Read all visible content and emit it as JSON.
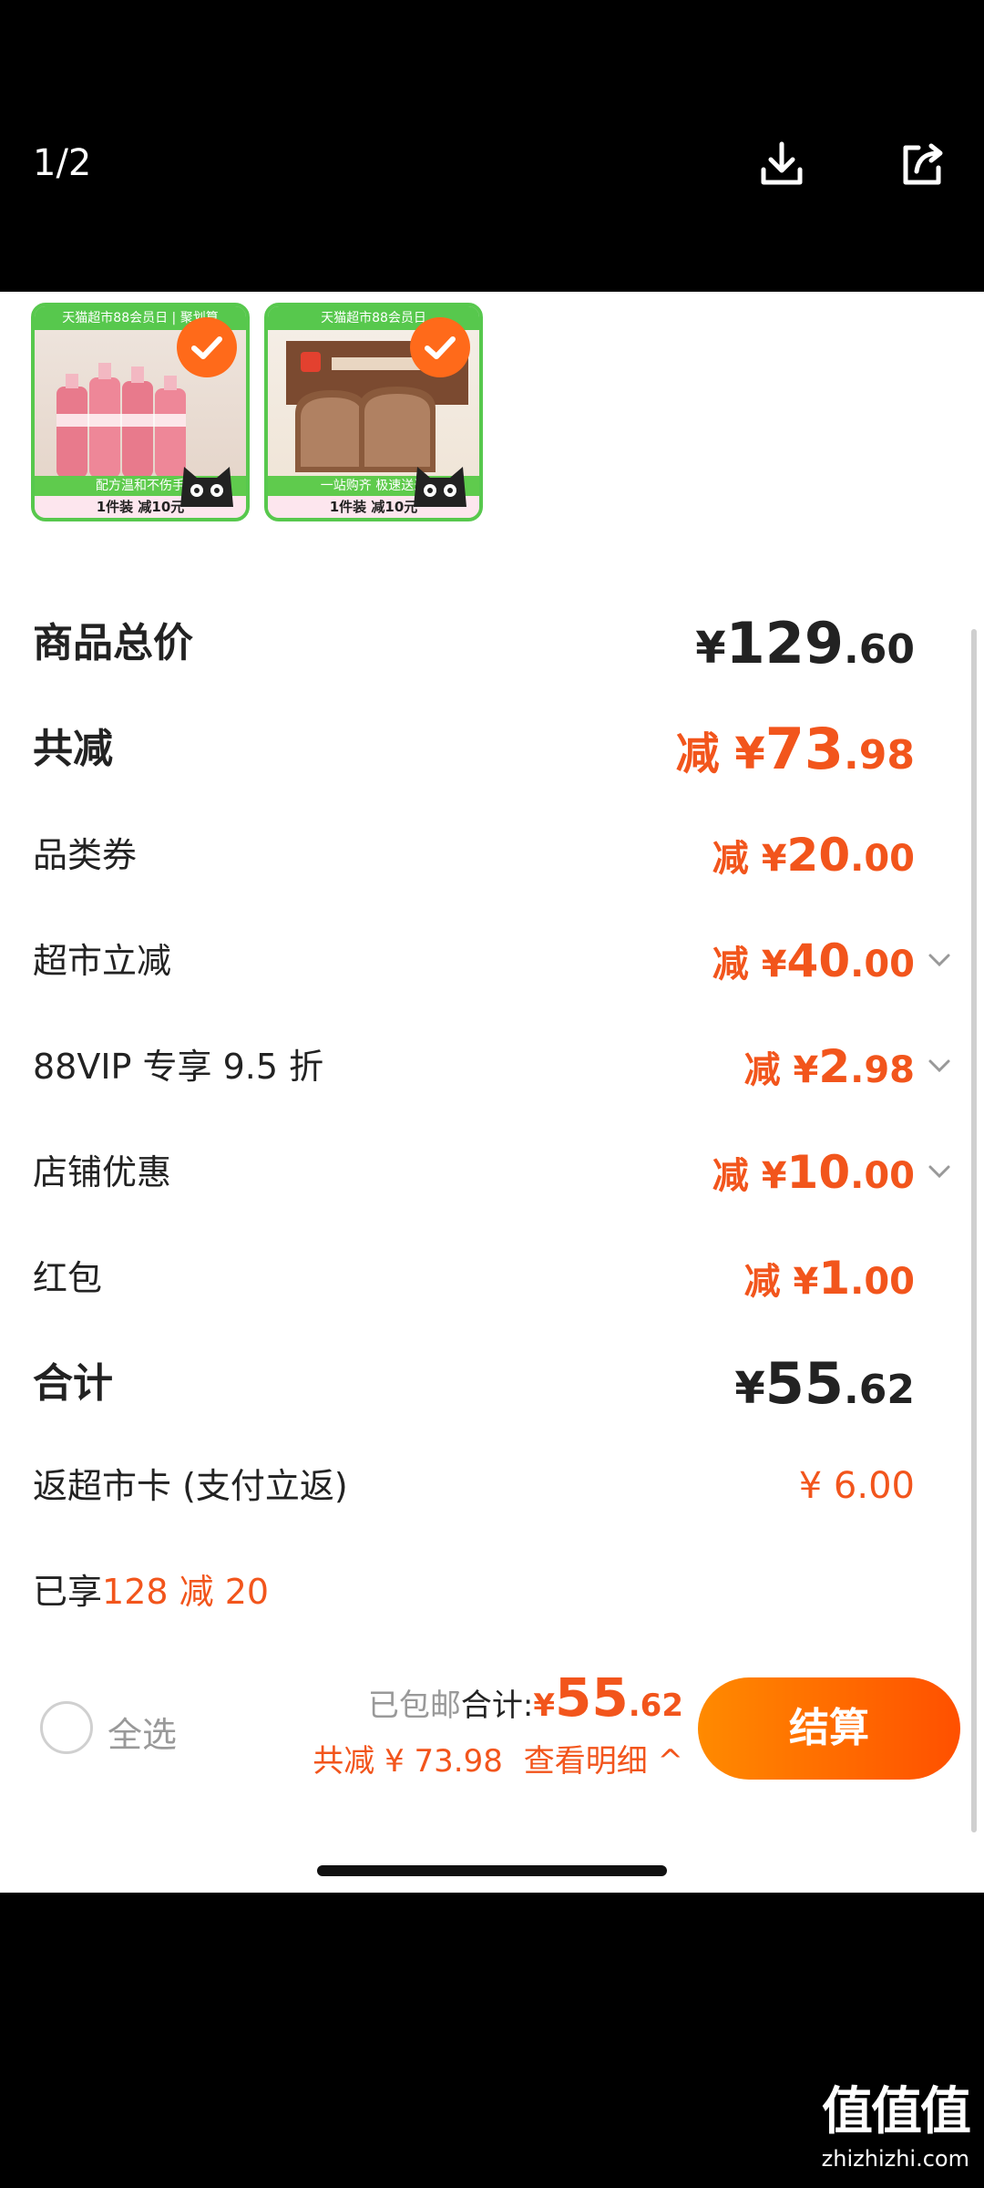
{
  "viewer": {
    "page_counter": "1/2"
  },
  "products": [
    {
      "ribbon": "天猫超市88会员日 | 聚划算",
      "banner": "配方温和不伤手",
      "promo": "1件装 减10元"
    },
    {
      "ribbon": "天猫超市88会员日",
      "banner": "一站购齐 极速送达",
      "promo": "1件装 减10元"
    }
  ],
  "breakdown": {
    "total_label": "商品总价",
    "total_prefix": "¥",
    "total_int": "129",
    "total_dec": ".60",
    "reduce_label": "共减",
    "reduce_prefix": "减 ¥",
    "reduce_int": "73",
    "reduce_dec": ".98",
    "items": [
      {
        "label": "品类券",
        "prefix": "减 ¥",
        "int": "20",
        "dec": ".00"
      },
      {
        "label": "超市立减",
        "prefix": "减 ¥",
        "int": "40",
        "dec": ".00"
      },
      {
        "label": "88VIP 专享 9.5 折",
        "prefix": "减 ¥",
        "int": "2",
        "dec": ".98"
      },
      {
        "label": "店铺优惠",
        "prefix": "减 ¥",
        "int": "10",
        "dec": ".00"
      },
      {
        "label": "红包",
        "prefix": "减 ¥",
        "int": "1",
        "dec": ".00"
      }
    ],
    "sum_label": "合计",
    "sum_prefix": "¥",
    "sum_int": "55",
    "sum_dec": ".62",
    "cashback_label": "返超市卡 (支付立返)",
    "cashback_value": "¥ 6.00",
    "enjoyed_prefix": "已享",
    "enjoyed_value": "128 减 20"
  },
  "footer": {
    "select_all": "全选",
    "shipping": "已包邮",
    "sum_label": "合计:",
    "sum_prefix": "¥",
    "sum_int": "55",
    "sum_dec": ".62",
    "reduce_text": "共减 ¥ 73.98",
    "detail_text": "查看明细 ^",
    "pay_button": "结算"
  },
  "watermark": {
    "logo": "值值值",
    "site": "zhizhizhi.com"
  },
  "colors": {
    "accent": "#f2551c",
    "green": "#57c84d",
    "button_start": "#ff8a00",
    "button_end": "#ff5000"
  }
}
